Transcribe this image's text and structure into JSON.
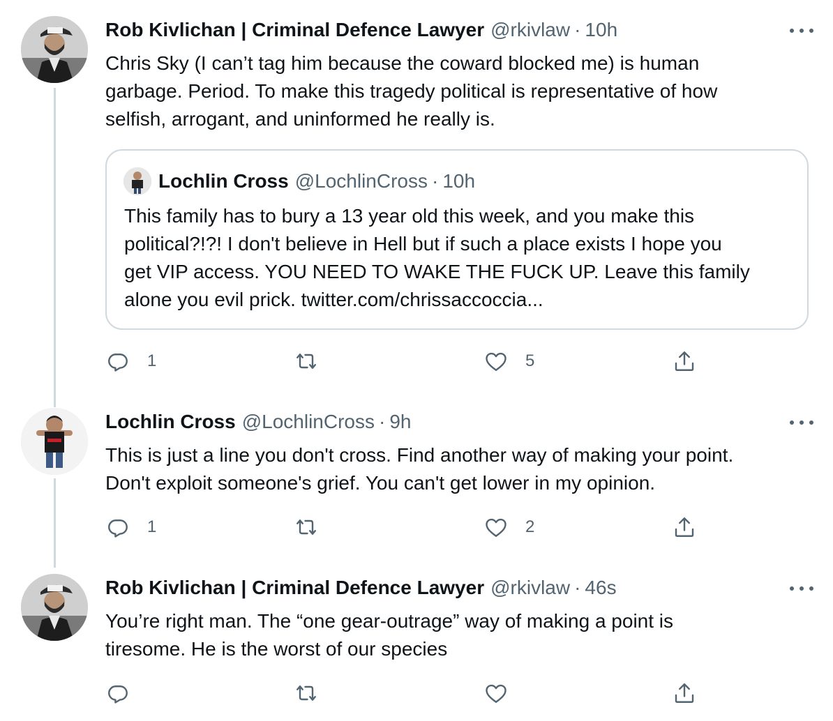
{
  "tweets": [
    {
      "author_name": "Rob Kivlichan | Criminal Defence Lawyer",
      "handle": "@rkivlaw",
      "separator": "·",
      "time": "10h",
      "lines": [
        "Chris Sky (I can’t tag him because the coward blocked me) is human",
        "garbage. Period. To make this tragedy political is representative of how",
        "selfish, arrogant, and uninformed he really is."
      ],
      "quote": {
        "author_name": "Lochlin Cross",
        "handle": "@LochlinCross",
        "separator": "·",
        "time": "10h",
        "lines": [
          "This family has to bury a 13 year old this week, and you make this",
          "political?!?! I don't believe in Hell but if such a place exists I hope you",
          "get VIP access. YOU NEED TO WAKE THE FUCK UP. Leave this family",
          "alone you evil prick. twitter.com/chrissaccoccia..."
        ]
      },
      "reply_count": "1",
      "retweet_count": "",
      "like_count": "5"
    },
    {
      "author_name": "Lochlin Cross",
      "handle": "@LochlinCross",
      "separator": "·",
      "time": "9h",
      "lines": [
        "This is just a line you don't cross. Find another way of making your point.",
        "Don't exploit someone's grief. You can't get lower in my opinion."
      ],
      "reply_count": "1",
      "retweet_count": "",
      "like_count": "2"
    },
    {
      "author_name": "Rob Kivlichan | Criminal Defence Lawyer",
      "handle": "@rkivlaw",
      "separator": "·",
      "time": "46s",
      "lines": [
        "You’re right man. The “one gear-outrage” way of making a point is",
        "tiresome. He is the worst of our species"
      ],
      "reply_count": "",
      "retweet_count": "",
      "like_count": ""
    }
  ],
  "icons": {
    "reply": "reply-icon",
    "retweet": "retweet-icon",
    "like": "heart-icon",
    "share": "share-icon",
    "more": "more-options-icon"
  },
  "colors": {
    "text_primary": "#0f1419",
    "text_secondary": "#536471",
    "border": "#cfd9de"
  }
}
